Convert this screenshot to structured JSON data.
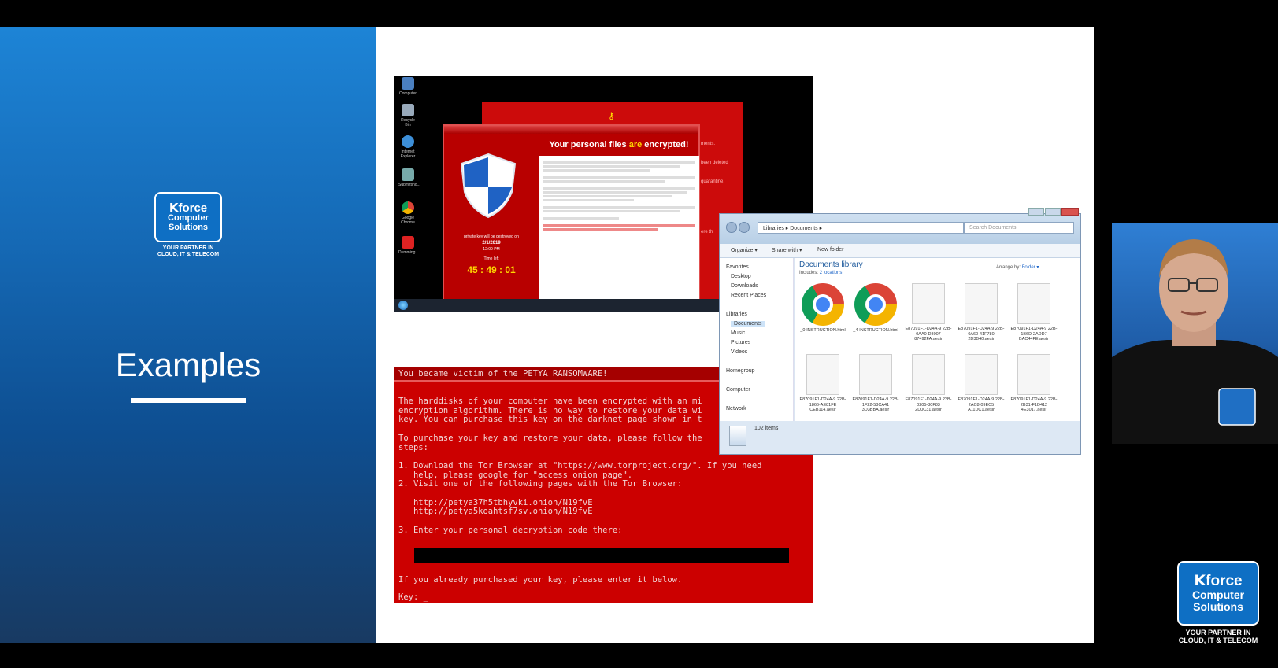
{
  "slide": {
    "title": "Examples",
    "logo": {
      "letter": "K",
      "line1": "force",
      "line2": "Computer",
      "line3": "Solutions",
      "tagline": "YOUR PARTNER IN CLOUD, IT & TELECOM"
    }
  },
  "wannacry": {
    "desktop_icons": [
      "Computer",
      "Recycle Bin",
      "Internet Explorer",
      "Submitting...",
      "Google Chrome",
      "Dumming..."
    ],
    "header_start": "Your personal files ",
    "header_mid": "are",
    "header_end": " encrypted!",
    "key_label": "private key will be destroyed on",
    "date": "2/1/2019",
    "time_label": "12:00 PM",
    "time_left_label": "Time left",
    "timer": "45 : 49 : 01",
    "side_text": [
      "ments.",
      "been deleted",
      "quarantine.",
      "ere th"
    ]
  },
  "explorer": {
    "breadcrumb": "Libraries ▸ Documents ▸",
    "search_placeholder": "Search Documents",
    "toolbar": [
      "Organize ▾",
      "Share with ▾",
      "New folder"
    ],
    "nav": [
      "Favorites",
      "Desktop",
      "Downloads",
      "Recent Places",
      "Libraries",
      "Documents",
      "Music",
      "Pictures",
      "Videos",
      "Homegroup",
      "Computer",
      "Network"
    ],
    "library_title": "Documents library",
    "includes_label": "Includes:",
    "includes_link": "2 locations",
    "arrange_label": "Arrange by:",
    "arrange_value": "Folder ▾",
    "files": [
      {
        "name": "_0-INSTRUCTION.html",
        "type": "chrome"
      },
      {
        "name": "_4-INSTRUCTION.html",
        "type": "chrome"
      },
      {
        "name": "E87091F1-D24A-9 22B-0AA0-D8007 87492FA.aesir",
        "type": "doc"
      },
      {
        "name": "E87091F1-D24A-9 22B-0A60-41F780 2D3B40.aesir",
        "type": "doc"
      },
      {
        "name": "E87091F1-D24A-9 22B-1B6D-2ADD7 BAC44FE.aesir",
        "type": "doc"
      },
      {
        "name": "E87091F1-D24A-9 22B-1866-AE81FE CEB114.aesir",
        "type": "doc"
      },
      {
        "name": "E87091F1-D24A-9 22B-1F22-58CA41 3D3BBA.aesir",
        "type": "doc"
      },
      {
        "name": "E87091F1-D24A-9 22B-0205-30F83 2D0C31.aesir",
        "type": "doc"
      },
      {
        "name": "E87091F1-D24A-9 22B-2AC8-09EC5 A11DC1.aesir",
        "type": "doc"
      },
      {
        "name": "E87091F1-D24A-9 22B-2B31-F1D412 4E3017.aesir",
        "type": "doc"
      }
    ],
    "status": "102 items"
  },
  "petya": {
    "title": "You became victim of the PETYA RANSOMWARE!",
    "lines": [
      "The harddisks of your computer have been encrypted with an mi",
      "encryption algorithm. There is no way to restore your data wi",
      "key. You can purchase this key on the darknet page shown in t",
      "",
      "To purchase your key and restore your data, please follow the",
      "steps:",
      "",
      "1. Download the Tor Browser at \"https://www.torproject.org/\". If you need",
      "   help, please google for \"access onion page\".",
      "2. Visit one of the following pages with the Tor Browser:",
      "",
      "   http://petya37h5tbhyvki.onion/N19fvE",
      "   http://petya5koahtsf7sv.onion/N19fvE",
      "",
      "3. Enter your personal decryption code there:"
    ],
    "footer": "If you already purchased your key, please enter it below.",
    "key_prompt": "Key: _"
  }
}
